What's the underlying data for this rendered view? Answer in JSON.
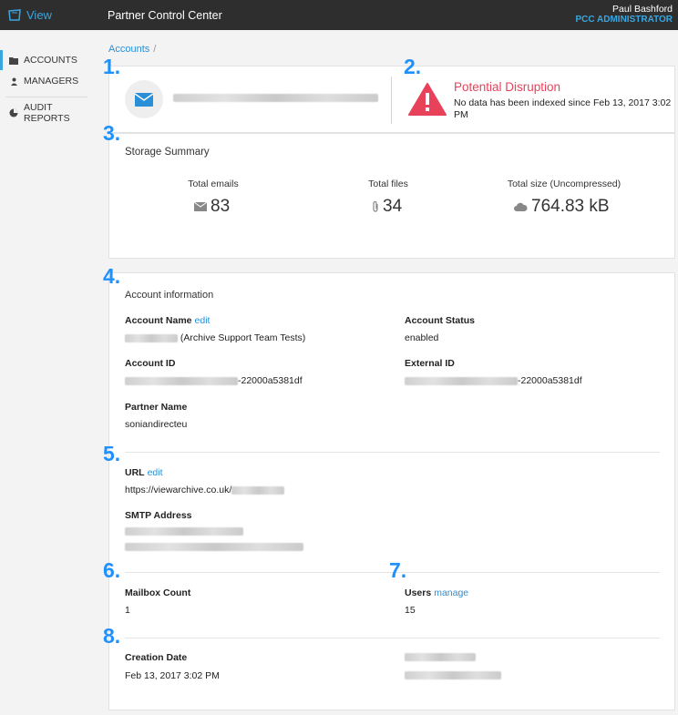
{
  "app": {
    "brand": "View",
    "title": "Partner Control Center"
  },
  "user": {
    "name": "Paul Bashford",
    "role": "PCC ADMINISTRATOR"
  },
  "sidebar": {
    "items": [
      {
        "label": "ACCOUNTS",
        "icon": "folder-icon"
      },
      {
        "label": "MANAGERS",
        "icon": "user-icon"
      },
      {
        "label": "AUDIT REPORTS",
        "icon": "pie-chart-icon"
      }
    ]
  },
  "breadcrumb": {
    "root": "Accounts",
    "separator": "/"
  },
  "annotations": [
    "1.",
    "2.",
    "3.",
    "4.",
    "5.",
    "6.",
    "7.",
    "8."
  ],
  "alert": {
    "title": "Potential Disruption",
    "message": "No data has been indexed since Feb 13, 2017 3:02 PM"
  },
  "storage": {
    "title": "Storage Summary",
    "emails_label": "Total emails",
    "emails_value": "83",
    "files_label": "Total files",
    "files_value": "34",
    "size_label": "Total size (Uncompressed)",
    "size_value": "764.83 kB"
  },
  "account": {
    "title": "Account information",
    "name_label": "Account Name",
    "name_edit": "edit",
    "name_value_suffix": "(Archive Support Team Tests)",
    "status_label": "Account Status",
    "status_value": "enabled",
    "id_label": "Account ID",
    "id_value_suffix": "-22000a5381df",
    "external_id_label": "External ID",
    "external_id_value_suffix": "-22000a5381df",
    "partner_label": "Partner Name",
    "partner_value": "soniandirecteu",
    "url_label": "URL",
    "url_edit": "edit",
    "url_value": "https://viewarchive.co.uk/",
    "smtp_label": "SMTP Address",
    "mailbox_label": "Mailbox Count",
    "mailbox_value": "1",
    "users_label": "Users",
    "users_manage": "manage",
    "users_value": "15",
    "creation_label": "Creation Date",
    "creation_value": "Feb 13, 2017 3:02 PM"
  },
  "colors": {
    "accent": "#3aa6e0",
    "link": "#2a8fd6",
    "alert": "#e8425a",
    "annotation": "#1e90ff",
    "topbar": "#2e2e2e"
  }
}
